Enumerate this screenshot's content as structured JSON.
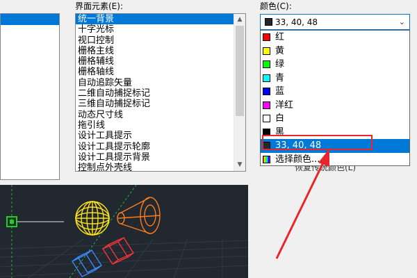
{
  "labels": {
    "elements": "界面元素(E):",
    "color": "颜色(C):",
    "restore_button": "恢复传统颜色(L)"
  },
  "interface_elements": [
    "统一背景",
    "十字光标",
    "视口控制",
    "栅格主线",
    "栅格辅线",
    "栅格轴线",
    "自动追踪矢量",
    "二维自动捕捉标记",
    "三维自动捕捉标记",
    "动态尺寸线",
    "拖引线",
    "设计工具提示",
    "设计工具提示轮廓",
    "设计工具提示背景",
    "控制点外壳线"
  ],
  "selected_element": "统一背景",
  "selected_color": {
    "label": "33, 40, 48",
    "hex": "#212830"
  },
  "color_options": [
    {
      "label": "红",
      "hex": "#ff0000"
    },
    {
      "label": "黄",
      "hex": "#ffff00"
    },
    {
      "label": "绿",
      "hex": "#00ff00"
    },
    {
      "label": "青",
      "hex": "#00ffff"
    },
    {
      "label": "蓝",
      "hex": "#0000ff"
    },
    {
      "label": "洋红",
      "hex": "#ff00ff"
    },
    {
      "label": "白",
      "hex": "#ffffff"
    },
    {
      "label": "黑",
      "hex": "#000000"
    },
    {
      "label": "33, 40, 48",
      "hex": "#212830"
    },
    {
      "label": "选择颜色...",
      "hex": "rainbow"
    }
  ],
  "highlighted_option": "33, 40, 48",
  "colors": {
    "preview_background": "#21282f",
    "selection_blue": "#0078d7",
    "annotation_red": "#e8262a"
  }
}
